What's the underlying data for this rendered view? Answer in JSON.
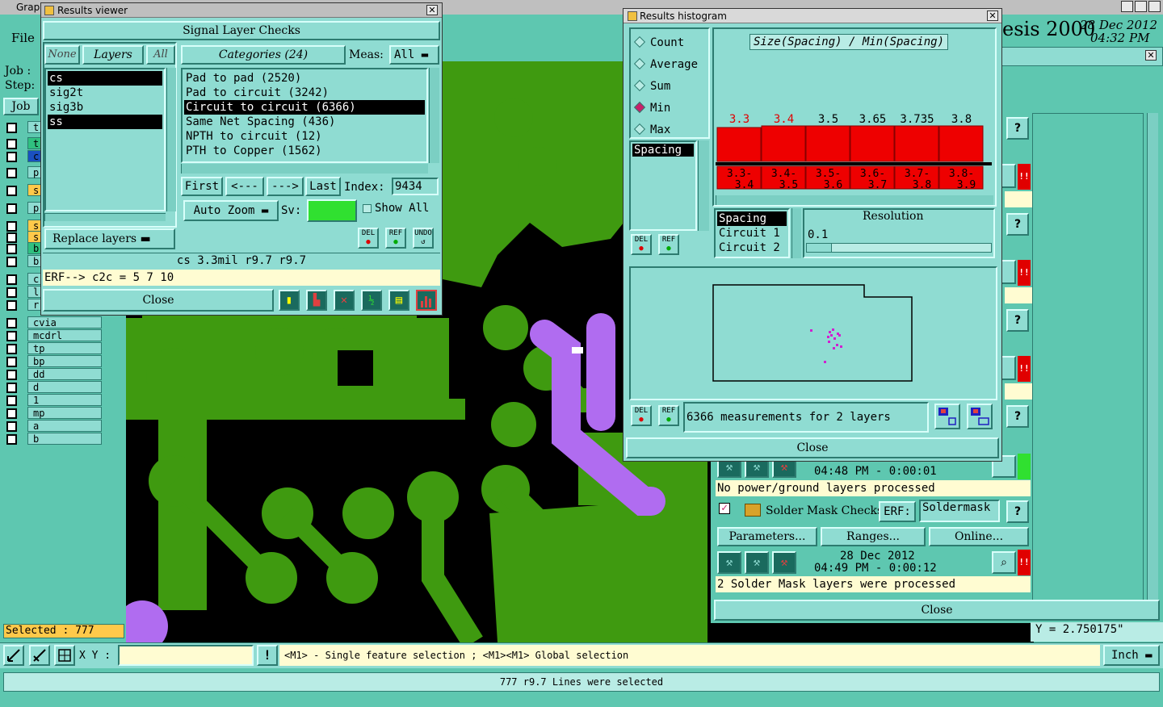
{
  "main": {
    "title_prefix": "Grap",
    "menu_file": "File",
    "job_label": "Job :",
    "step_label": "Step:",
    "job_button": "Job",
    "brand": "esis 2000",
    "date": "28 Dec 2012",
    "time": "04:32 PM",
    "selected": "Selected : 777",
    "xy_label": "X Y :",
    "xy_value": "",
    "hint": "<M1> - Single feature selection ; <M1><M1> Global selection",
    "unit": "Inch",
    "status": "777 r9.7 Lines were selected",
    "y_readout": "Y = 2.750175\""
  },
  "layers": [
    {
      "name": "t"
    },
    {
      "name": "t"
    },
    {
      "name": "c"
    },
    {
      "name": "p"
    },
    {
      "name": "s"
    },
    {
      "name": "p"
    },
    {
      "name": "s"
    },
    {
      "name": "s"
    },
    {
      "name": "b"
    },
    {
      "name": "b"
    },
    {
      "name": "c"
    },
    {
      "name": "l"
    },
    {
      "name": "r"
    },
    {
      "name": "cvia"
    },
    {
      "name": "mcdrl"
    },
    {
      "name": "tp"
    },
    {
      "name": "bp"
    },
    {
      "name": "dd"
    },
    {
      "name": "d"
    },
    {
      "name": "1"
    },
    {
      "name": "mp"
    },
    {
      "name": "a"
    },
    {
      "name": "b"
    }
  ],
  "viewer": {
    "title": "Results viewer",
    "header": "Signal Layer Checks",
    "none_btn": "None",
    "layers_btn": "Layers",
    "all_btn": "All",
    "layer_list": [
      "cs",
      "sig2t",
      "sig3b",
      "ss"
    ],
    "categories_label": "Categories (24)",
    "meas_label": "Meas:",
    "meas_value": "All",
    "categories": [
      "Pad to pad (2520)",
      "Pad to circuit (3242)",
      "Circuit to circuit (6366)",
      "Same Net Spacing (436)",
      "NPTH to circuit (12)",
      "PTH to Copper (1562)"
    ],
    "first": "First",
    "prev": "<---",
    "next": "--->",
    "last": "Last",
    "index_label": "Index:",
    "index_value": "9434",
    "auto_zoom": "Auto Zoom",
    "sv_label": "Sv:",
    "show_all": "Show All",
    "replace_layers": "Replace layers",
    "icon_del": "DEL",
    "icon_ref": "REF",
    "icon_undo": "UNDO",
    "info_line": "cs 3.3mil   r9.7   r9.7",
    "erf_line": "ERF--> c2c = 5 7 10",
    "close": "Close"
  },
  "histogram": {
    "title": "Results histogram",
    "modes": [
      "Count",
      "Average",
      "Sum",
      "Min",
      "Max"
    ],
    "selected_mode": "Min",
    "list_item": "Spacing",
    "chart_title": "Size(Spacing) / Min(Spacing)",
    "details_list": [
      "Spacing",
      "Circuit 1",
      "Circuit 2"
    ],
    "resolution_label": "Resolution",
    "resolution_value": "0.1",
    "measurements": "6366 measurements for 2 layers",
    "close": "Close",
    "icon_del": "DEL",
    "icon_ref": "REF"
  },
  "chart_data": {
    "type": "bar",
    "title": "Size(Spacing) / Min(Spacing)",
    "categories": [
      "3.3-3.4",
      "3.4-3.5",
      "3.5-3.6",
      "3.6-3.7",
      "3.7-3.8",
      "3.8-3.9"
    ],
    "values": [
      3.3,
      3.4,
      3.5,
      3.65,
      3.735,
      3.8
    ],
    "value_labels": [
      "3.3",
      "3.4",
      "3.5",
      "3.65",
      "3.735",
      "3.8"
    ],
    "bin_labels": [
      [
        "3.3-",
        "3.4"
      ],
      [
        "3.4-",
        "3.5"
      ],
      [
        "3.5-",
        "3.6"
      ],
      [
        "3.6-",
        "3.7"
      ],
      [
        "3.7-",
        "3.8"
      ],
      [
        "3.8-",
        "3.9"
      ]
    ],
    "bar_color": "#ee0000",
    "red_labels": [
      true,
      true,
      false,
      false,
      false,
      false
    ]
  },
  "right_panel": {
    "row1_time": "04:48 PM - 0:00:01",
    "row1_status": "No power/ground layers processed",
    "solder_title": "Solder Mask Checks",
    "erf_label": "ERF:",
    "erf_value": "Soldermask",
    "parameters": "Parameters...",
    "ranges": "Ranges...",
    "online": "Online...",
    "solder_date": "28 Dec 2012",
    "solder_time": "04:49 PM - 0:00:12",
    "solder_status": "2 Solder Mask layers were processed",
    "close": "Close",
    "help": "?",
    "alert": "!!"
  },
  "colors": {
    "copper": "#3f9a10",
    "trace_selected": "#b06cf0",
    "background": "#000000",
    "ui": "#8fdcd2"
  }
}
